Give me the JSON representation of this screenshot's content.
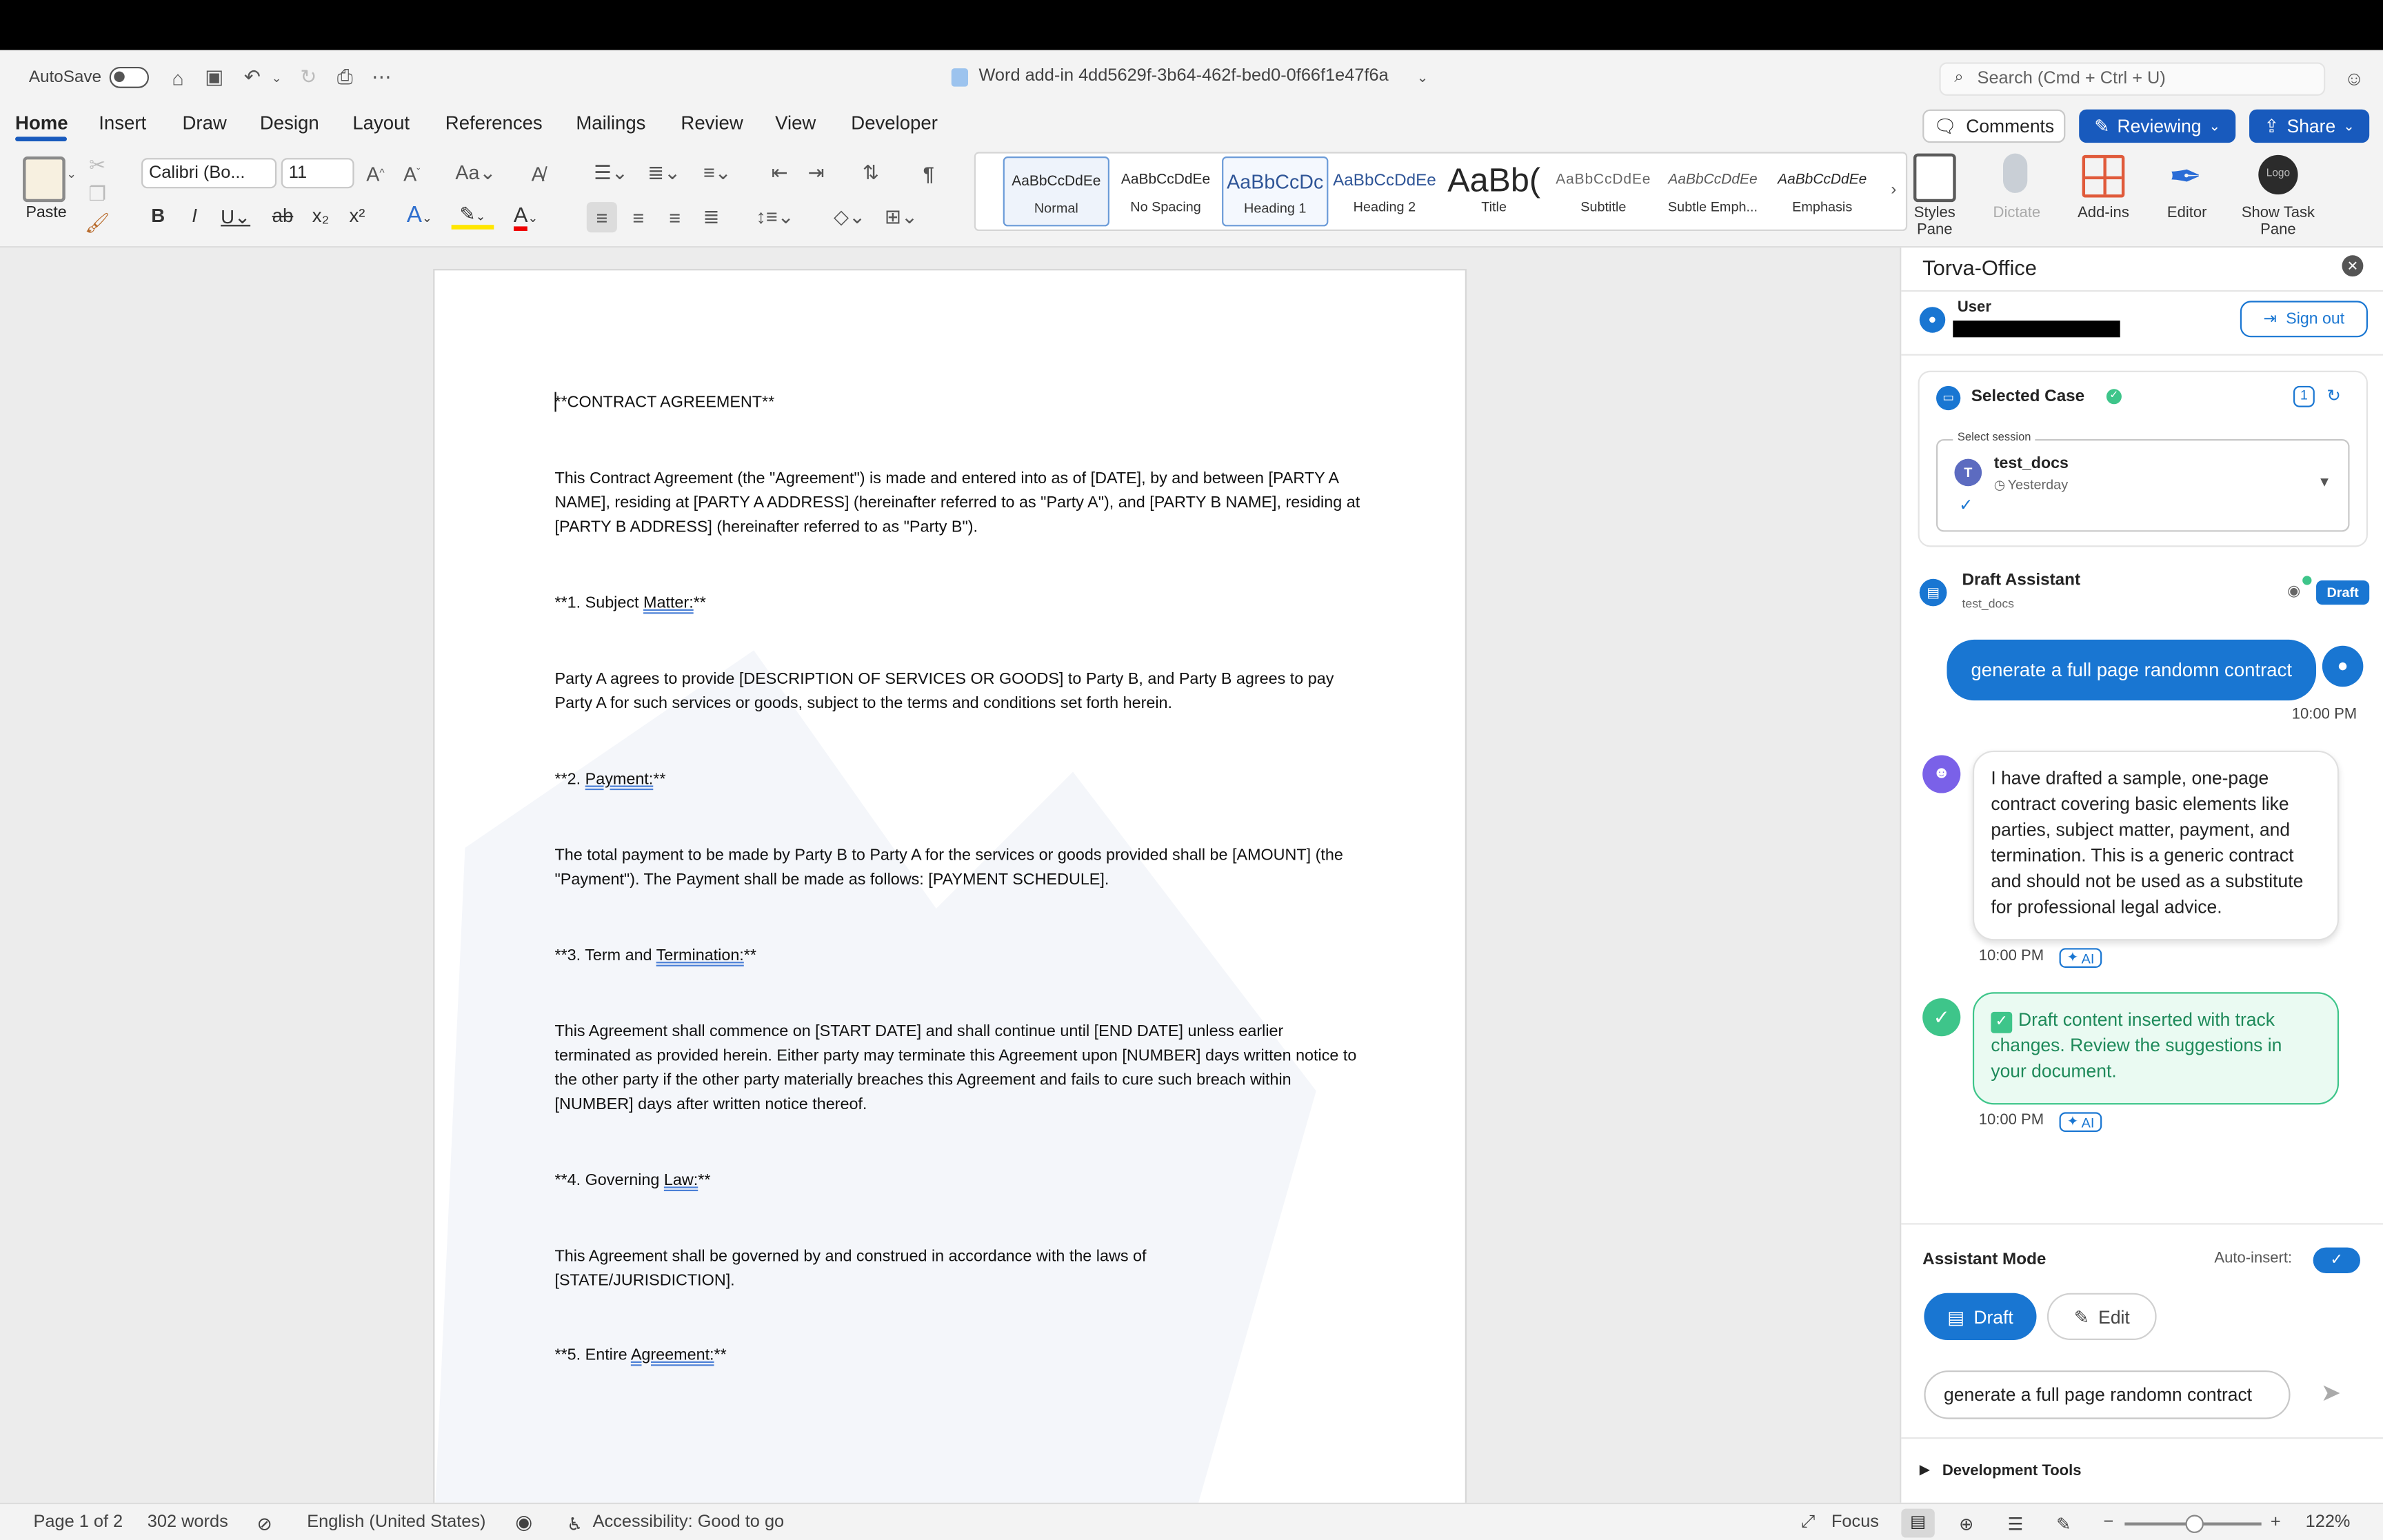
{
  "titlebar": {
    "autosave_label": "AutoSave",
    "document_title": "Word add-in 4dd5629f-3b64-462f-bed0-0f66f1e47f6a",
    "search_placeholder": "Search (Cmd + Ctrl + U)"
  },
  "tabs": [
    "Home",
    "Insert",
    "Draw",
    "Design",
    "Layout",
    "References",
    "Mailings",
    "Review",
    "View",
    "Developer"
  ],
  "active_tab": "Home",
  "top_actions": {
    "comments": "Comments",
    "reviewing": "Reviewing",
    "share": "Share"
  },
  "ribbon": {
    "paste_label": "Paste",
    "font_name": "Calibri (Bo...",
    "font_size": "11",
    "styles": [
      {
        "preview": "AaBbCcDdEe",
        "name": "Normal"
      },
      {
        "preview": "AaBbCcDdEe",
        "name": "No Spacing"
      },
      {
        "preview": "AaBbCcDc",
        "name": "Heading 1"
      },
      {
        "preview": "AaBbCcDdEe",
        "name": "Heading 2"
      },
      {
        "preview": "AaBb(",
        "name": "Title"
      },
      {
        "preview": "AaBbCcDdEe",
        "name": "Subtitle"
      },
      {
        "preview": "AaBbCcDdEe",
        "name": "Subtle Emph..."
      },
      {
        "preview": "AaBbCcDdEe",
        "name": "Emphasis"
      }
    ],
    "styles_pane": "Styles Pane",
    "dictate": "Dictate",
    "add_ins": "Add-ins",
    "editor": "Editor",
    "show_task_pane": "Show Task Pane",
    "logo_text": "Logo"
  },
  "document": {
    "p1": "**CONTRACT AGREEMENT**",
    "p2": "This Contract Agreement (the \"Agreement\") is made and entered into as of [DATE], by and between [PARTY A NAME], residing at [PARTY A ADDRESS] (hereinafter referred to as \"Party A\"), and [PARTY B NAME], residing at [PARTY B ADDRESS] (hereinafter referred to as \"Party B\").",
    "h1_pre": "**1. Subject ",
    "h1_ul": "Matter:",
    "h1_post": "**",
    "p3": "Party A agrees to provide [DESCRIPTION OF SERVICES OR GOODS] to Party B, and Party B agrees to pay Party A for such services or goods, subject to the terms and conditions set forth herein.",
    "h2_pre": "**2. ",
    "h2_ul": "Payment:",
    "h2_post": "**",
    "p4": "The total payment to be made by Party B to Party A for the services or goods provided shall be [AMOUNT] (the \"Payment\"). The Payment shall be made as follows: [PAYMENT SCHEDULE].",
    "h3_pre": "**3. Term and ",
    "h3_ul": "Termination:",
    "h3_post": "**",
    "p5": "This Agreement shall commence on [START DATE] and shall continue until [END DATE] unless earlier terminated as provided herein. Either party may terminate this Agreement upon [NUMBER] days written notice to the other party if the other party materially breaches this Agreement and fails to cure such breach within [NUMBER] days after written notice thereof.",
    "h4_pre": "**4. Governing ",
    "h4_ul": "Law:",
    "h4_post": "**",
    "p6": "This Agreement shall be governed by and construed in accordance with the laws of [STATE/JURISDICTION].",
    "h5_pre": "**5. Entire ",
    "h5_ul": "Agreement:",
    "h5_post": "**"
  },
  "pane": {
    "title": "Torva-Office",
    "user_label": "User",
    "sign_out": "Sign out",
    "selected_case": "Selected Case",
    "case_count": "1",
    "select_session_label": "Select session",
    "session_avatar": "T",
    "session_name": "test_docs",
    "session_time": "Yesterday",
    "draft_assistant": "Draft Assistant",
    "draft_sub": "test_docs",
    "draft_badge": "Draft",
    "messages": {
      "user_msg": "generate a full page randomn contract",
      "user_time": "10:00 PM",
      "bot_msg": "I have drafted a sample, one-page contract covering basic elements like parties, subject matter, payment, and termination. This is a generic contract and should not be used as a substitute for professional legal advice.",
      "bot_time": "10:00 PM",
      "ok_msg": "Draft content inserted with track changes. Review the suggestions in your document.",
      "ok_time": "10:00 PM",
      "ai_tag": "AI"
    },
    "assistant_mode": "Assistant Mode",
    "auto_insert": "Auto-insert:",
    "mode_draft": "Draft",
    "mode_edit": "Edit",
    "input_value": "generate a full page randomn contract",
    "dev_tools": "Development Tools"
  },
  "statusbar": {
    "page": "Page 1 of 2",
    "words": "302 words",
    "language": "English (United States)",
    "accessibility": "Accessibility: Good to go",
    "focus": "Focus",
    "zoom": "122%"
  },
  "colors": {
    "accent": "#185abd",
    "pane_blue": "#1976d2",
    "success": "#3ec58a"
  }
}
